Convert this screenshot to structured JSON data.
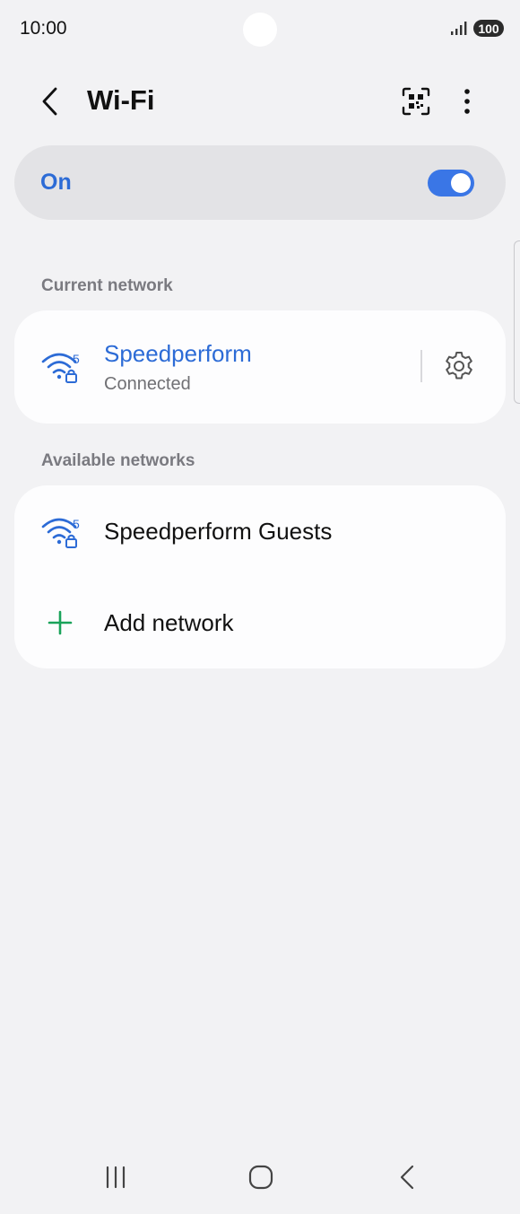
{
  "status_bar": {
    "time": "10:00",
    "battery": "100",
    "icons": [
      "signal-icon",
      "battery-icon"
    ]
  },
  "header": {
    "title": "Wi-Fi",
    "icons": [
      "back-arrow-icon",
      "qr-code-scan-icon",
      "more-options-icon"
    ]
  },
  "wifi_toggle": {
    "label": "On",
    "enabled": true,
    "accent_color": "#3a76e6"
  },
  "current_network": {
    "section_label": "Current network",
    "name": "Speedperform",
    "status": "Connected",
    "band_label": "5",
    "icons": [
      "wifi-5ghz-lock-icon",
      "settings-gear-icon"
    ]
  },
  "available_networks": {
    "section_label": "Available networks",
    "items": [
      {
        "name": "Speedperform Guests",
        "band_label": "5",
        "icon": "wifi-5ghz-lock-icon"
      }
    ],
    "add_network_label": "Add network",
    "add_icon": "plus-icon"
  },
  "nav_bar": {
    "icons": [
      "recent-apps-icon",
      "home-icon",
      "back-icon"
    ]
  },
  "colors": {
    "background": "#f2f2f4",
    "card": "#fdfdfe",
    "toggle_card": "#e3e3e6",
    "link_blue": "#2c6bd6",
    "add_green": "#1aa35a"
  }
}
